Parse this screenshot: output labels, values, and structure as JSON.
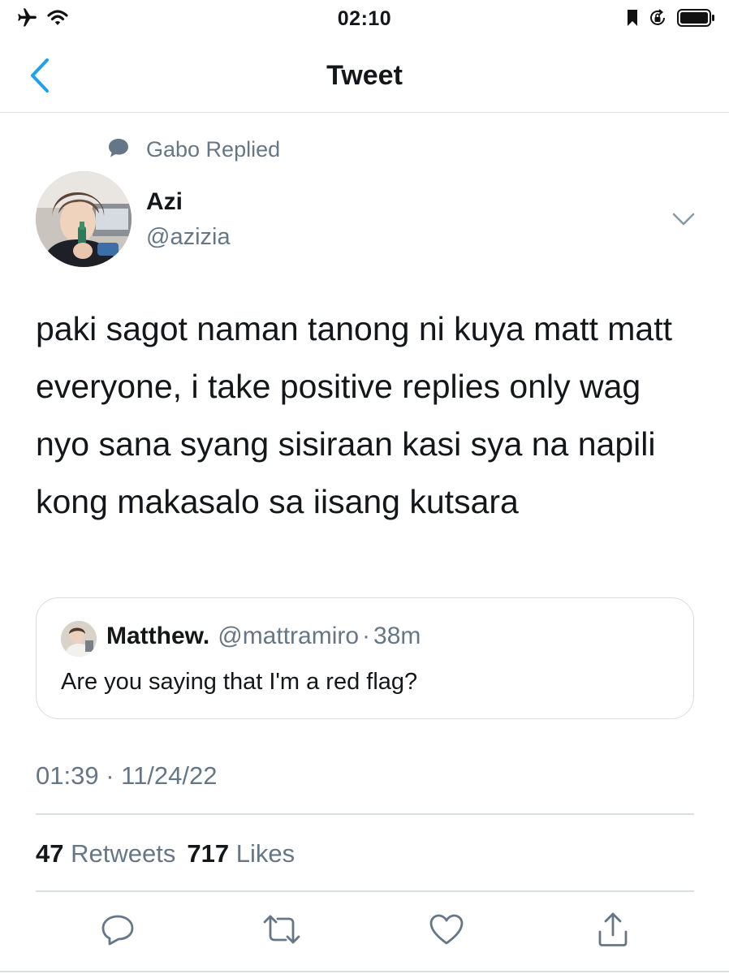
{
  "status_bar": {
    "time": "02:10"
  },
  "nav": {
    "title": "Tweet"
  },
  "social_context": {
    "text": "Gabo Replied"
  },
  "tweet": {
    "author_name": "Azi",
    "author_handle": "@azizia",
    "text": "paki sagot naman tanong ni kuya matt matt everyone, i take positive replies only wag nyo sana syang sisiraan kasi sya na napili kong makasalo sa iisang kutsara",
    "timestamp": "01:39 · 11/24/22"
  },
  "quote": {
    "author_name": "Matthew.",
    "author_handle": "@mattramiro",
    "separator": "·",
    "age": "38m",
    "text": "Are you saying that I'm a red flag?"
  },
  "stats": {
    "retweets_count": "47",
    "retweets_label": "Retweets",
    "likes_count": "717",
    "likes_label": "Likes"
  },
  "colors": {
    "text": "#14171a",
    "secondary": "#657786",
    "accent": "#1da1f2",
    "border": "#dcdfe2"
  },
  "icons": [
    "airplane-icon",
    "wifi-icon",
    "orientation-lock-icon",
    "battery-icon",
    "back-chevron-icon",
    "speech-bubble-icon",
    "chevron-down-icon",
    "reply-icon",
    "retweet-icon",
    "like-icon",
    "share-icon"
  ]
}
